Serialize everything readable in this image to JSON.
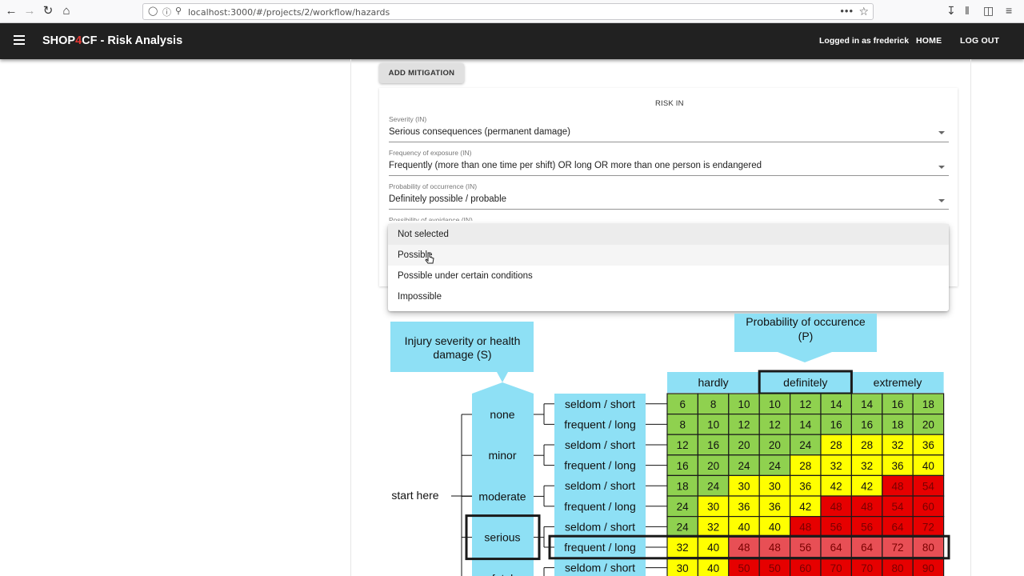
{
  "browser": {
    "url": "localhost:3000/#/projects/2/workflow/hazards",
    "back_icon": "arrow-left",
    "forward_icon": "arrow-right",
    "reload_icon": "reload",
    "home_icon": "home",
    "more_label": "•••",
    "star_icon": "star"
  },
  "appbar": {
    "brand_prefix": "SHOP",
    "brand_mid": "4",
    "brand_suffix": "CF - Risk Analysis",
    "logged_in": "Logged in as frederick",
    "home": "HOME",
    "logout": "LOG OUT"
  },
  "form": {
    "add_mitigation": "ADD MITIGATION",
    "risk_title": "RISK IN",
    "fields": [
      {
        "label": "Severity (IN)",
        "value": "Serious consequences (permanent damage)"
      },
      {
        "label": "Frequency of exposure (IN)",
        "value": "Frequently (more than one time per shift) OR long OR more than one person is endangered"
      },
      {
        "label": "Probability of occurrence (IN)",
        "value": "Definitely possible / probable"
      },
      {
        "label": "Possibility of avoidance (IN)",
        "value": ""
      }
    ]
  },
  "dropdown": {
    "options": [
      "Not selected",
      "Possible",
      "Possible under certain conditions",
      "Impossible"
    ],
    "selected_index": 0,
    "hover_index": 1
  },
  "graph": {
    "severity_header": [
      "Injury severity or health",
      "damage (S)"
    ],
    "probability_header": [
      "Probability of occurence",
      "(P)"
    ],
    "start_label": "start here",
    "probability_levels": [
      "hardly",
      "definitely",
      "extremely"
    ],
    "severity_levels": [
      "none",
      "minor",
      "moderate",
      "serious",
      "fatal"
    ],
    "frequency_levels": [
      "seldom / short",
      "frequent / long"
    ],
    "rows": [
      [
        6,
        8,
        10,
        10,
        12,
        14,
        14,
        16,
        18
      ],
      [
        8,
        10,
        12,
        12,
        14,
        16,
        16,
        18,
        20
      ],
      [
        12,
        16,
        20,
        20,
        24,
        28,
        28,
        32,
        36
      ],
      [
        16,
        20,
        24,
        24,
        28,
        32,
        32,
        36,
        40
      ],
      [
        18,
        24,
        30,
        30,
        36,
        42,
        42,
        48,
        54
      ],
      [
        24,
        30,
        36,
        36,
        42,
        48,
        48,
        54,
        60
      ],
      [
        24,
        32,
        40,
        40,
        48,
        56,
        56,
        64,
        72
      ],
      [
        32,
        40,
        48,
        48,
        56,
        64,
        64,
        72,
        80
      ],
      [
        30,
        40,
        50,
        50,
        60,
        70,
        70,
        80,
        90
      ]
    ],
    "colors": {
      "header_blue": "#8ee0f5",
      "green": "#8fd14f",
      "yellow": "#ffff00",
      "red": "#e60000",
      "light_red": "#e84f55",
      "border": "#1a1a1a"
    },
    "highlight": {
      "severity": "serious",
      "frequency": "frequent / long",
      "probability": "definitely"
    }
  }
}
